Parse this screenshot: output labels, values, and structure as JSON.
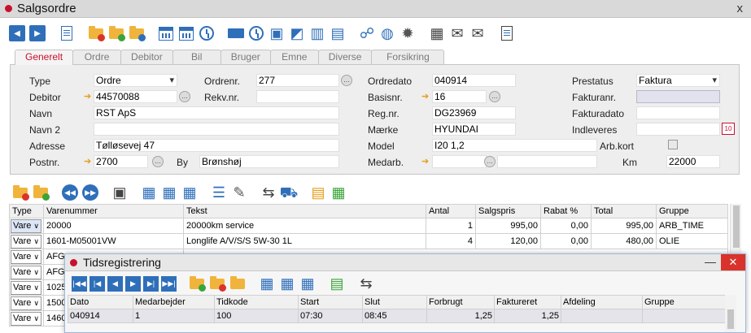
{
  "window": {
    "title": "Salgsordre",
    "close": "x"
  },
  "tabs": [
    "Generelt",
    "Ordre",
    "Debitor",
    "Bil",
    "Bruger",
    "Emne",
    "Diverse",
    "Forsikring"
  ],
  "form": {
    "type_label": "Type",
    "type_value": "Ordre",
    "ordrenr_label": "Ordrenr.",
    "ordrenr_value": "277",
    "ordredato_label": "Ordredato",
    "ordredato_value": "040914",
    "prestatus_label": "Prestatus",
    "prestatus_value": "Faktura",
    "debitor_label": "Debitor",
    "debitor_value": "44570088",
    "rekvnr_label": "Rekv.nr.",
    "rekvnr_value": "",
    "basisnr_label": "Basisnr.",
    "basisnr_value": "16",
    "fakturanr_label": "Fakturanr.",
    "fakturanr_value": "",
    "navn_label": "Navn",
    "navn_value": "RST ApS",
    "regnr_label": "Reg.nr.",
    "regnr_value": "DG23969",
    "fakturadato_label": "Fakturadato",
    "fakturadato_value": "",
    "navn2_label": "Navn 2",
    "navn2_value": "",
    "maerke_label": "Mærke",
    "maerke_value": "HYUNDAI",
    "indleveres_label": "Indleveres",
    "indleveres_value": "",
    "adresse_label": "Adresse",
    "adresse_value": "Tølløsevej 47",
    "model_label": "Model",
    "model_value": "I20 1,2",
    "arbkort_label": "Arb.kort",
    "postnr_label": "Postnr.",
    "postnr_value": "2700",
    "by_label": "By",
    "by_value": "Brønshøj",
    "medarb_label": "Medarb.",
    "medarb_value": "",
    "km_label": "Km",
    "km_value": "22000"
  },
  "lines": {
    "headers": [
      "Type",
      "Varenummer",
      "Tekst",
      "Antal",
      "Salgspris",
      "Rabat %",
      "Total",
      "Gruppe"
    ],
    "rows": [
      {
        "type": "Vare",
        "varenr": "20000",
        "tekst": "20000km service",
        "antal": "1",
        "pris": "995,00",
        "rabat": "0,00",
        "total": "995,00",
        "gruppe": "ARB_TIME"
      },
      {
        "type": "Vare",
        "varenr": "1601-M05001VW",
        "tekst": "Longlife A/V/S/S 5W-30 1L",
        "antal": "4",
        "pris": "120,00",
        "rabat": "0,00",
        "total": "480,00",
        "gruppe": "OLIE"
      },
      {
        "type": "Vare",
        "varenr": "AFG",
        "tekst": "",
        "antal": "",
        "pris": "",
        "rabat": "",
        "total": "",
        "gruppe": ""
      },
      {
        "type": "Vare",
        "varenr": "AFG",
        "tekst": "",
        "antal": "",
        "pris": "",
        "rabat": "",
        "total": "",
        "gruppe": ""
      },
      {
        "type": "Vare",
        "varenr": "1025",
        "tekst": "",
        "antal": "",
        "pris": "",
        "rabat": "",
        "total": "",
        "gruppe": ""
      },
      {
        "type": "Vare",
        "varenr": "1500",
        "tekst": "",
        "antal": "",
        "pris": "",
        "rabat": "",
        "total": "",
        "gruppe": ""
      },
      {
        "type": "Vare",
        "varenr": "1460",
        "tekst": "",
        "antal": "",
        "pris": "",
        "rabat": "",
        "total": "",
        "gruppe": ""
      }
    ]
  },
  "tid": {
    "title": "Tidsregistrering",
    "minimize": "—",
    "close": "✕",
    "headers": [
      "Dato",
      "Medarbejder",
      "Tidkode",
      "Start",
      "Slut",
      "Forbrugt",
      "Faktureret",
      "Afdeling",
      "Gruppe"
    ],
    "row": {
      "dato": "040914",
      "medarb": "1",
      "tidkode": "100",
      "start": "07:30",
      "slut": "08:45",
      "forbrugt": "1,25",
      "faktureret": "1,25",
      "afdeling": "",
      "gruppe": ""
    }
  },
  "icons": {
    "lookup": "…",
    "arrow": "➔",
    "calendar": "10"
  }
}
